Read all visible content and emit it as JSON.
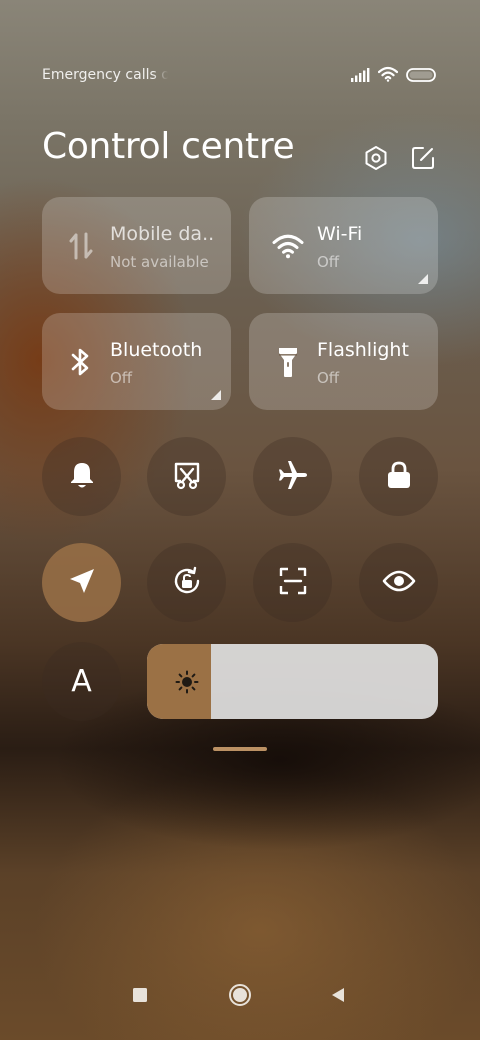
{
  "status_bar": {
    "text": "Emergency calls o",
    "icons": [
      "signal-icon",
      "wifi-icon",
      "battery-icon"
    ]
  },
  "header": {
    "title": "Control centre",
    "icons": [
      "settings-icon",
      "edit-icon"
    ]
  },
  "tiles": [
    {
      "name": "Mobile da..",
      "status": "Not available",
      "icon": "mobile-data-icon"
    },
    {
      "name": "Wi-Fi",
      "status": "Off",
      "icon": "wifi-icon"
    },
    {
      "name": "Bluetooth",
      "status": "Off",
      "icon": "bluetooth-icon"
    },
    {
      "name": "Flashlight",
      "status": "Off",
      "icon": "flashlight-icon"
    }
  ],
  "toggles": [
    {
      "icon": "bell-icon",
      "active": false
    },
    {
      "icon": "screenshot-icon",
      "active": false
    },
    {
      "icon": "airplane-icon",
      "active": false
    },
    {
      "icon": "lock-icon",
      "active": false
    },
    {
      "icon": "location-icon",
      "active": true
    },
    {
      "icon": "rotation-lock-icon",
      "active": false
    },
    {
      "icon": "scan-icon",
      "active": false
    },
    {
      "icon": "eye-icon",
      "active": false
    }
  ],
  "auto_brightness": {
    "label": "A"
  },
  "brightness": {
    "level": 0.22,
    "icon": "sun-icon"
  },
  "nav": {
    "icons": [
      "recents-icon",
      "home-icon",
      "back-icon"
    ]
  },
  "colors": {
    "active_toggle": "#9b7145",
    "brightness_fill": "#9b7145",
    "handle": "#cda06e"
  }
}
